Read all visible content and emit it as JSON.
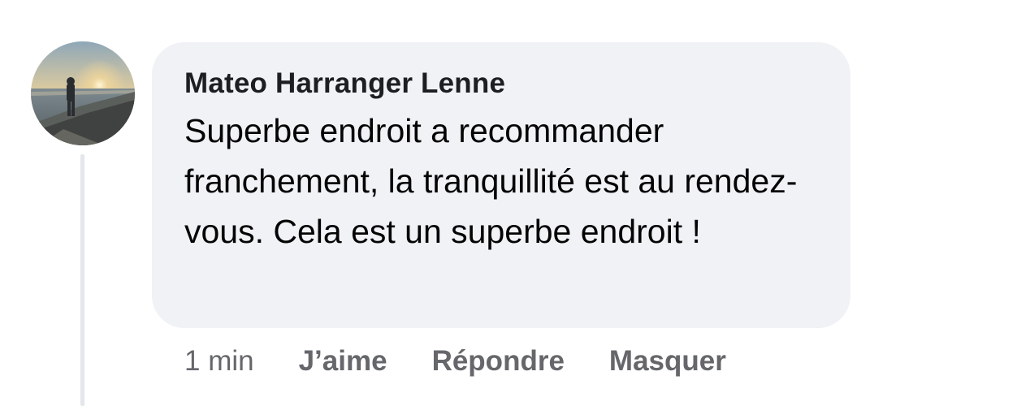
{
  "comment": {
    "author": "Mateo Harranger Lenne",
    "text": "Superbe endroit a recommander franchement, la tranquillité est au rendez-vous. Cela est un superbe endroit !",
    "timestamp": "1 min",
    "actions": {
      "like": "J’aime",
      "reply": "Répondre",
      "hide": "Masquer"
    }
  },
  "colors": {
    "bubble_background": "#f0f2f5",
    "action_text": "#65676b",
    "thread_line": "#e4e6eb"
  }
}
